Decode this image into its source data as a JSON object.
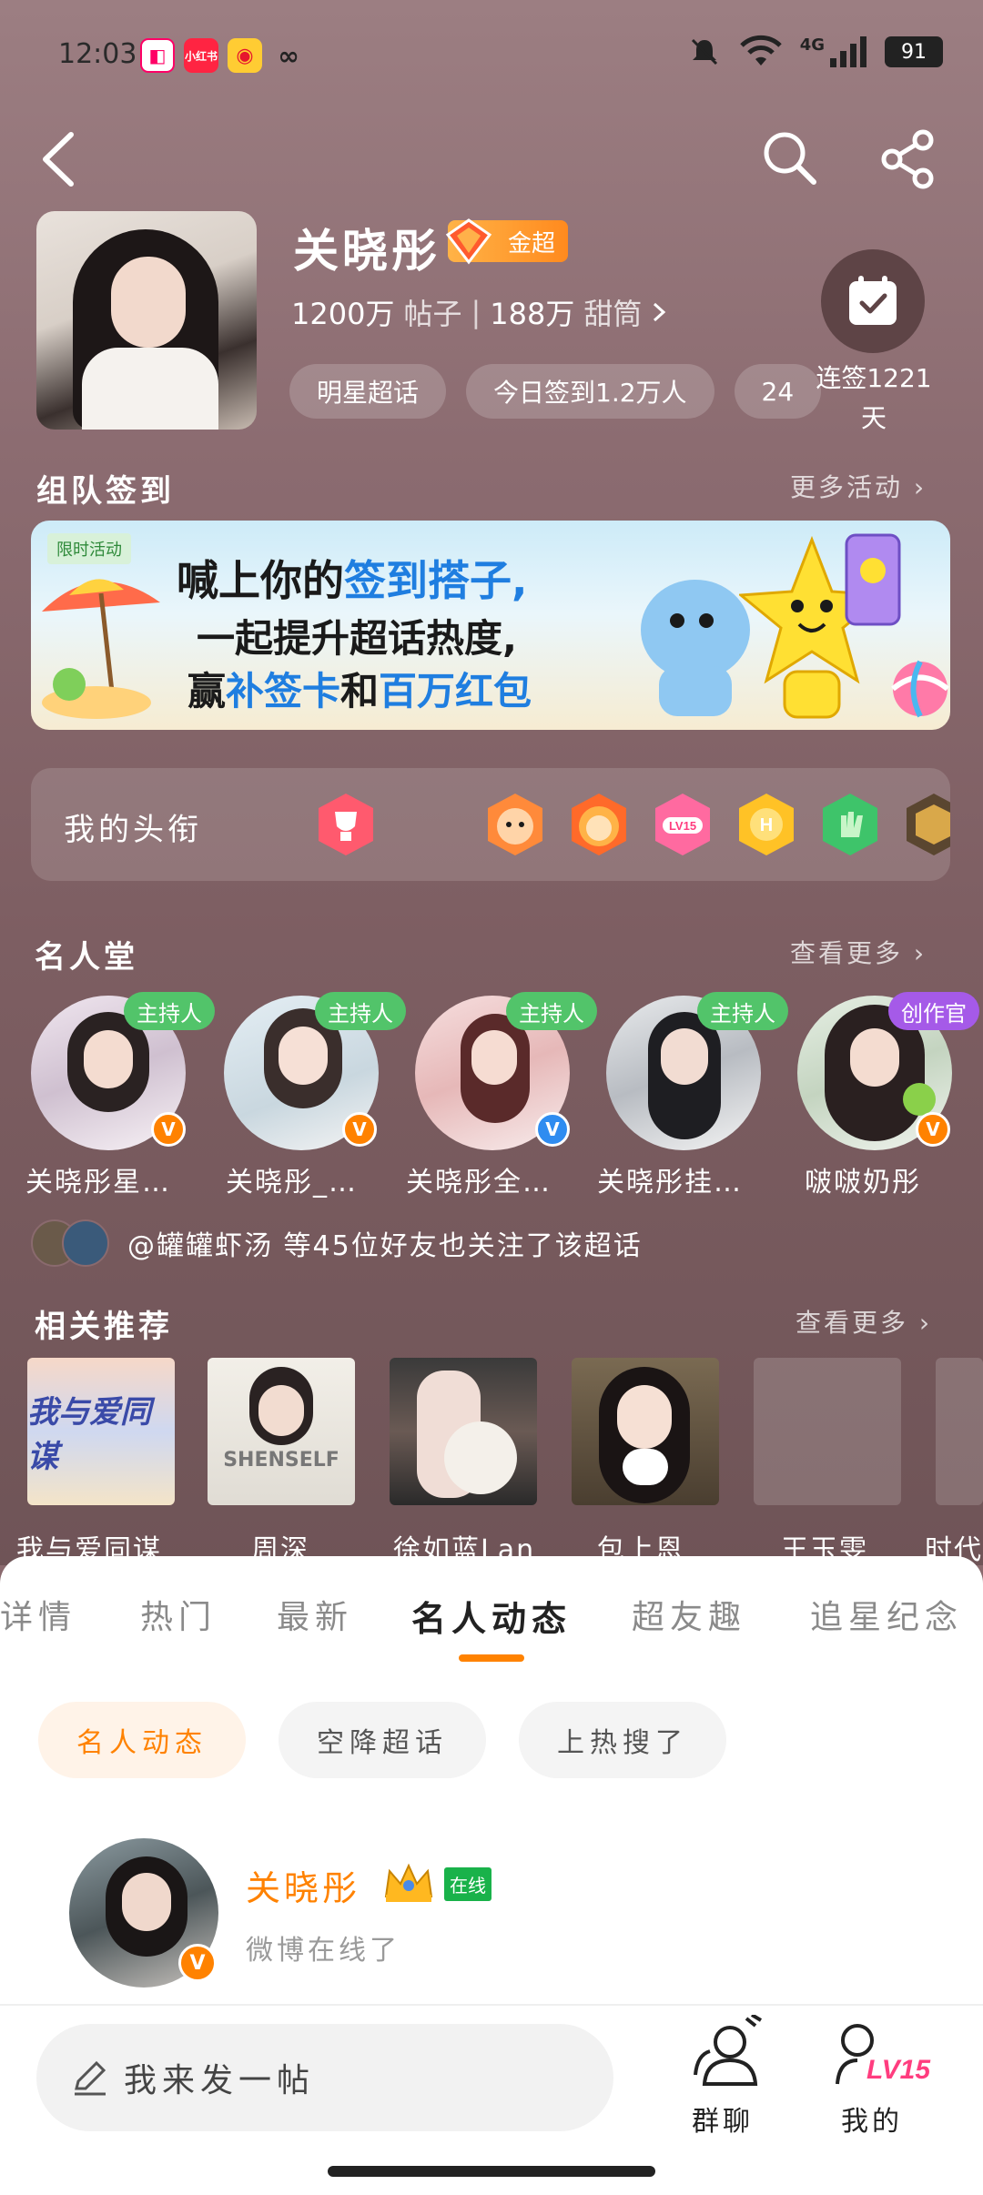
{
  "status_bar": {
    "time": "12:03",
    "battery": "91",
    "network": "4G"
  },
  "header": {
    "title": "关晓彤",
    "badge": "金超",
    "posts_count": "1200万",
    "posts_label": "帖子",
    "fans_count": "188万",
    "fans_label": "甜筒",
    "pills": [
      "明星超话",
      "今日签到1.2万人",
      "24"
    ],
    "checkin_label_line1": "连签1221",
    "checkin_label_line2": "天"
  },
  "team_checkin": {
    "title": "组队签到",
    "more": "更多活动",
    "banner": {
      "tag": "限时活动",
      "line1_a": "喊上你的",
      "line1_b": "签到搭子,",
      "line2": "一起提升超话热度,",
      "line3_a": "赢",
      "line3_b": "补签卡",
      "line3_c": "和",
      "line3_d": "百万红包"
    }
  },
  "titles_row": {
    "label": "我的头衔",
    "medals": [
      "trophy-medal-icon",
      "monkey-medal-icon",
      "lion-medal-icon",
      "lv15-medal-icon",
      "h-medal-icon",
      "hand-medal-icon",
      "super-medal-icon"
    ]
  },
  "hall_of_fame": {
    "title": "名人堂",
    "more": "查看更多",
    "items": [
      {
        "role": "主持人",
        "name": "关晓彤星…",
        "verify": "V",
        "verify_color": "#ff8200"
      },
      {
        "role": "主持人",
        "name": "关晓彤_…",
        "verify": "V",
        "verify_color": "#ff8200"
      },
      {
        "role": "主持人",
        "name": "关晓彤全…",
        "verify": "V",
        "verify_color": "#2f8cf0"
      },
      {
        "role": "主持人",
        "name": "关晓彤挂…",
        "verify": "",
        "verify_color": ""
      },
      {
        "role": "创作官",
        "name": "啵啵奶彤",
        "verify": "V",
        "verify_color": "#ff8200"
      }
    ],
    "friends_text": "@罐罐虾汤 等45位好友也关注了该超话"
  },
  "related": {
    "title": "相关推荐",
    "more": "查看更多",
    "items": [
      {
        "name": "我与爱同谋",
        "cover_text": "我与爱同谋"
      },
      {
        "name": "周深",
        "cover_text": "SHENSELF"
      },
      {
        "name": "徐如蓝Lan",
        "cover_text": ""
      },
      {
        "name": "包上恩",
        "cover_text": ""
      },
      {
        "name": "王玉雯",
        "cover_text": ""
      },
      {
        "name": "时代",
        "cover_text": ""
      }
    ]
  },
  "tabs": [
    "详情",
    "热门",
    "最新",
    "名人动态",
    "超友趣",
    "追星纪念"
  ],
  "active_tab": "名人动态",
  "chips": [
    "名人动态",
    "空降超话",
    "上热搜了"
  ],
  "post": {
    "name": "关晓彤",
    "online": "在线",
    "text": "微博在线了"
  },
  "bottom_bar": {
    "compose_placeholder": "我来发一帖",
    "group_chat": "群聊",
    "mine": "我的",
    "level": "LV15"
  },
  "colors": {
    "accent": "#ff8200",
    "hero_bg": "#8a6a6e",
    "host_green": "#52c46a",
    "creator_purple": "#a55ae8"
  }
}
